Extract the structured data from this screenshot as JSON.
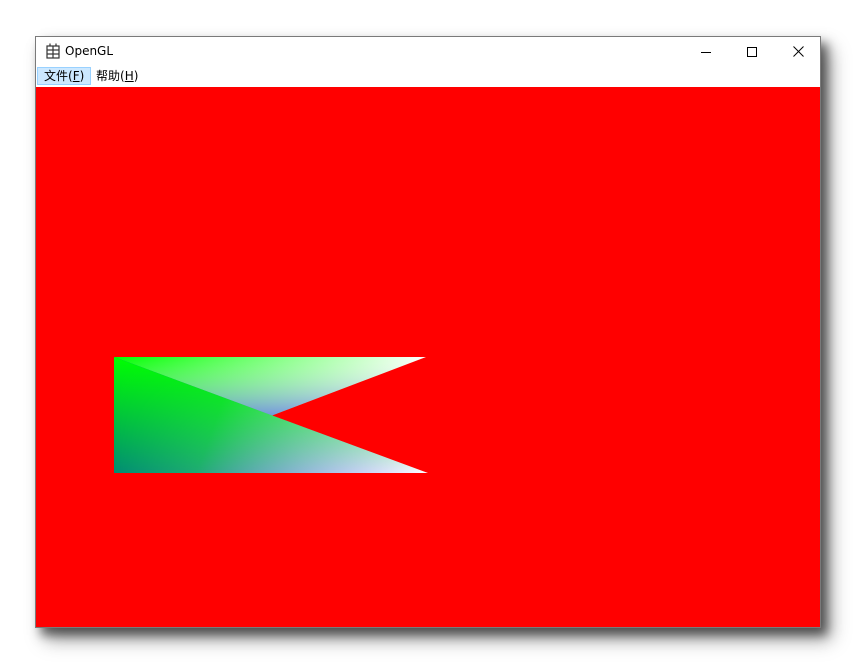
{
  "window": {
    "title": "OpenGL",
    "controls": {
      "minimize": "minimize",
      "maximize": "maximize",
      "close": "close"
    }
  },
  "menu": {
    "items": [
      {
        "label": "文件(",
        "mnemonic": "F",
        "suffix": ")",
        "active": true
      },
      {
        "label": "帮助(",
        "mnemonic": "H",
        "suffix": ")",
        "active": false
      }
    ]
  },
  "scene": {
    "background_color": "#ff0000",
    "vertex_colors": {
      "green": "#00ff00",
      "blue": "#0000ff",
      "white": "#ffffff"
    }
  }
}
